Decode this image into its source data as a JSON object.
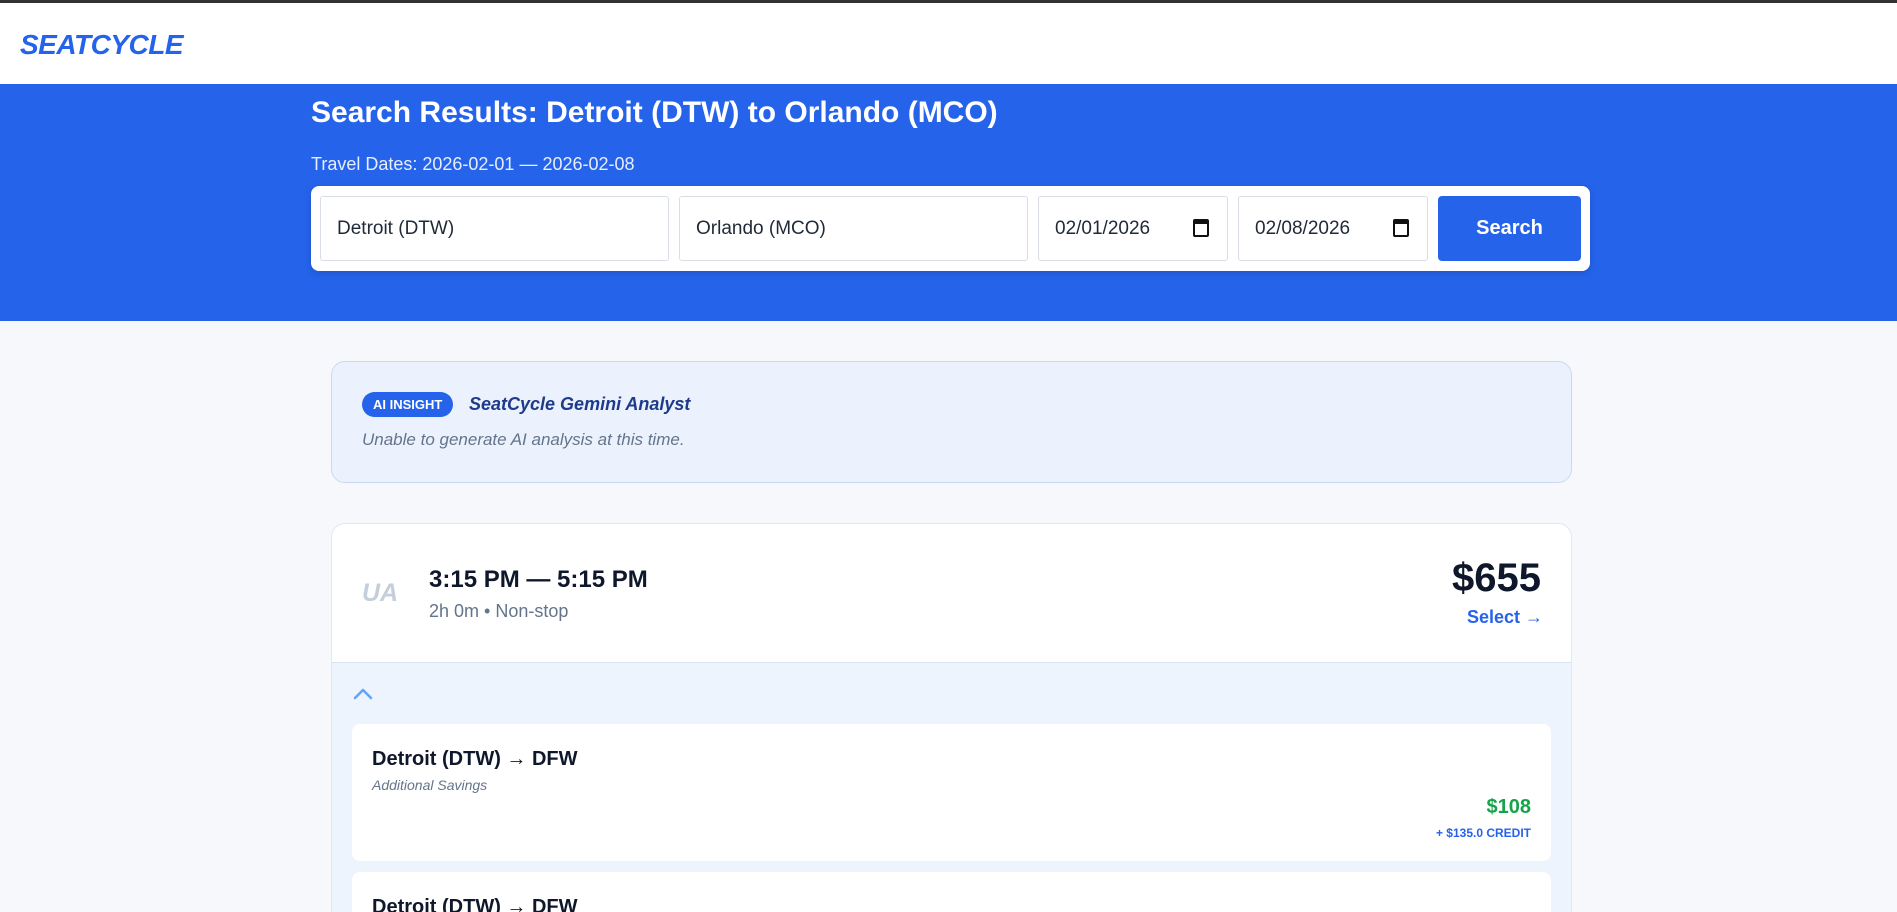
{
  "header": {
    "logo": "SEATCYCLE"
  },
  "hero": {
    "title": "Search Results: Detroit (DTW) to Orlando (MCO)",
    "dates": "Travel Dates: 2026-02-01 — 2026-02-08"
  },
  "search": {
    "origin": "Detroit (DTW)",
    "destination": "Orlando (MCO)",
    "depart_date": "02/01/2026",
    "return_date": "02/08/2026",
    "button_label": "Search"
  },
  "ai_insight": {
    "badge": "AI INSIGHT",
    "name": "SeatCycle Gemini Analyst",
    "message": "Unable to generate AI analysis at this time."
  },
  "flight": {
    "airline": "UA",
    "times": "3:15 PM — 5:15 PM",
    "meta": "2h 0m • Non-stop",
    "price": "$655",
    "select_label": "Select →",
    "legs": [
      {
        "route": "Detroit (DTW) → DFW",
        "subtitle": "Additional Savings",
        "price": "$108",
        "credit": "+ $135.0 CREDIT"
      },
      {
        "route": "Detroit (DTW) → DFW"
      }
    ]
  },
  "colors": {
    "accent": "#2563eb",
    "savings": "#16a34a",
    "muted": "#64748b"
  }
}
